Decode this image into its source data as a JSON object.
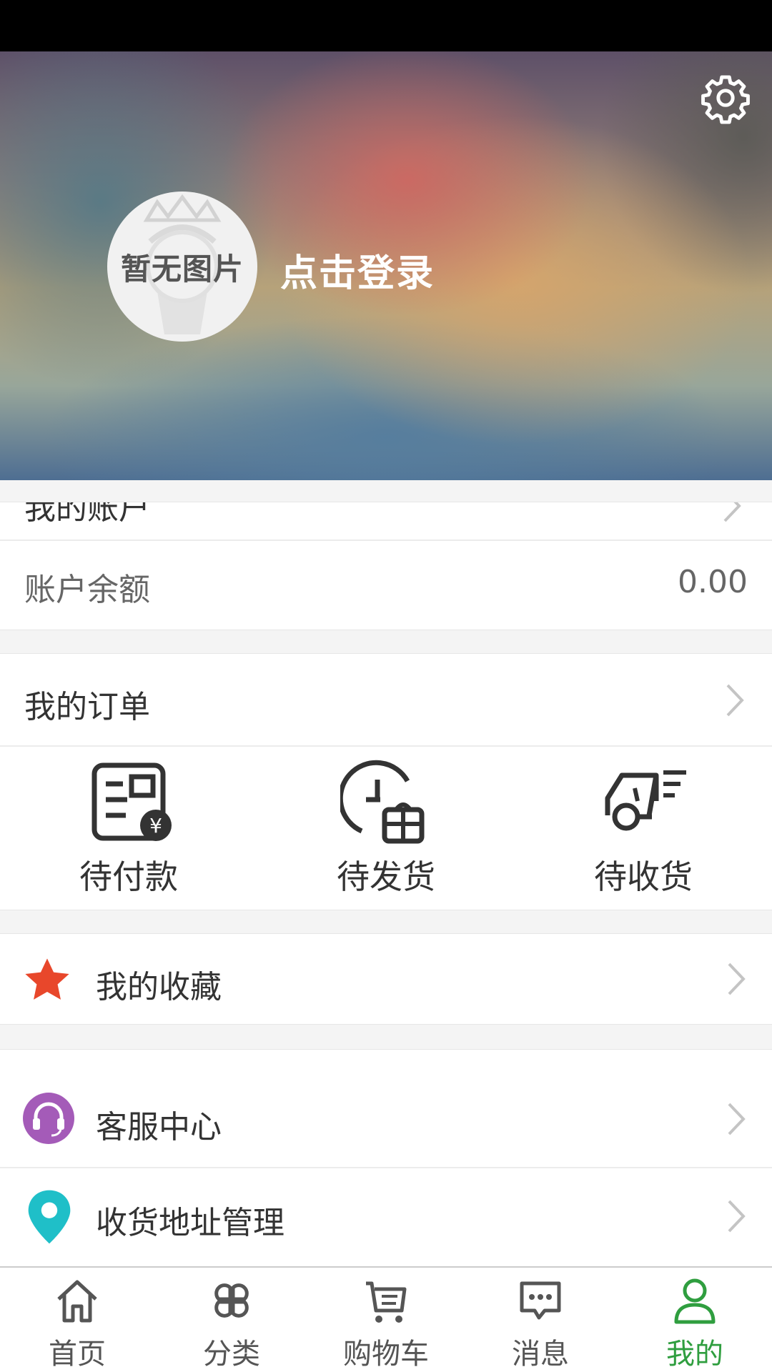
{
  "profile": {
    "avatar_placeholder": "暂无图片",
    "login_label": "点击登录"
  },
  "account": {
    "partial_row_label": "我的账户",
    "balance_label": "账户余额",
    "balance_value": "0.00"
  },
  "orders": {
    "title": "我的订单",
    "statuses": [
      {
        "label": "待付款",
        "icon": "pending-payment-icon"
      },
      {
        "label": "待发货",
        "icon": "pending-shipment-icon"
      },
      {
        "label": "待收货",
        "icon": "pending-delivery-icon"
      }
    ]
  },
  "favorites": {
    "label": "我的收藏",
    "icon": "star-icon",
    "color": "#e8472b"
  },
  "services": [
    {
      "label": "客服中心",
      "icon": "headset-icon",
      "color": "#a45bb8"
    },
    {
      "label": "收货地址管理",
      "icon": "location-pin-icon",
      "color": "#1fbfc8"
    }
  ],
  "tabbar": {
    "active_color": "#2f9e3f",
    "items": [
      {
        "label": "首页",
        "icon": "home-icon"
      },
      {
        "label": "分类",
        "icon": "category-icon"
      },
      {
        "label": "购物车",
        "icon": "cart-icon"
      },
      {
        "label": "消息",
        "icon": "message-icon"
      },
      {
        "label": "我的",
        "icon": "profile-icon",
        "active": true
      }
    ]
  }
}
